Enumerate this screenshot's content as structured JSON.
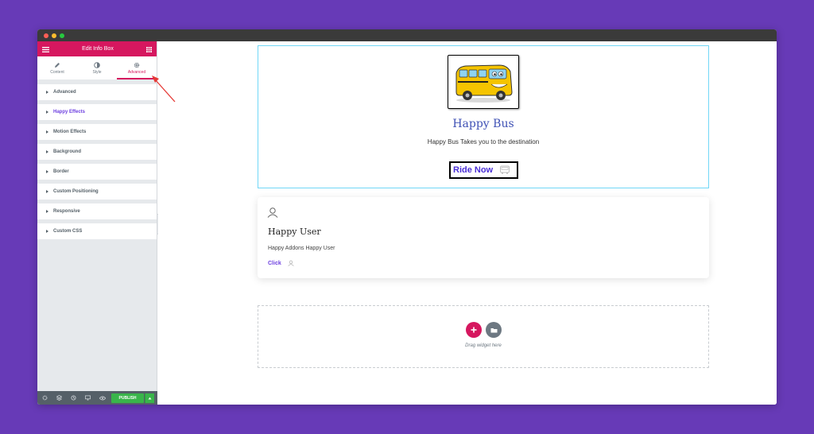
{
  "colors": {
    "background": "#673ab7",
    "panel_header": "#d6175f",
    "accent": "#d6175f",
    "publish": "#39b54a",
    "link": "#6d3fe0",
    "title_blue": "#3f51b5"
  },
  "panel": {
    "title": "Edit Info Box",
    "tabs": [
      {
        "label": "Content",
        "icon": "pencil-icon"
      },
      {
        "label": "Style",
        "icon": "contrast-icon"
      },
      {
        "label": "Advanced",
        "icon": "gear-icon",
        "active": true
      }
    ],
    "sections": [
      {
        "label": "Advanced"
      },
      {
        "label": "Happy Effects",
        "highlighted": true
      },
      {
        "label": "Motion Effects"
      },
      {
        "label": "Background"
      },
      {
        "label": "Border"
      },
      {
        "label": "Custom Positioning"
      },
      {
        "label": "Responsive"
      },
      {
        "label": "Custom CSS"
      }
    ],
    "footer": {
      "icons": [
        "settings-icon",
        "navigator-icon",
        "history-icon",
        "responsive-icon",
        "preview-icon"
      ],
      "publish_label": "PUBLISH"
    }
  },
  "canvas": {
    "infobox1": {
      "title": "Happy Bus",
      "description": "Happy Bus Takes you to the destination",
      "button_label": "Ride Now",
      "image": "school-bus-cartoon"
    },
    "infobox2": {
      "icon": "user-icon",
      "title": "Happy User",
      "description": "Happy Addons Happy User",
      "link_label": "Click"
    },
    "dropzone": {
      "text": "Drag widget here"
    }
  }
}
